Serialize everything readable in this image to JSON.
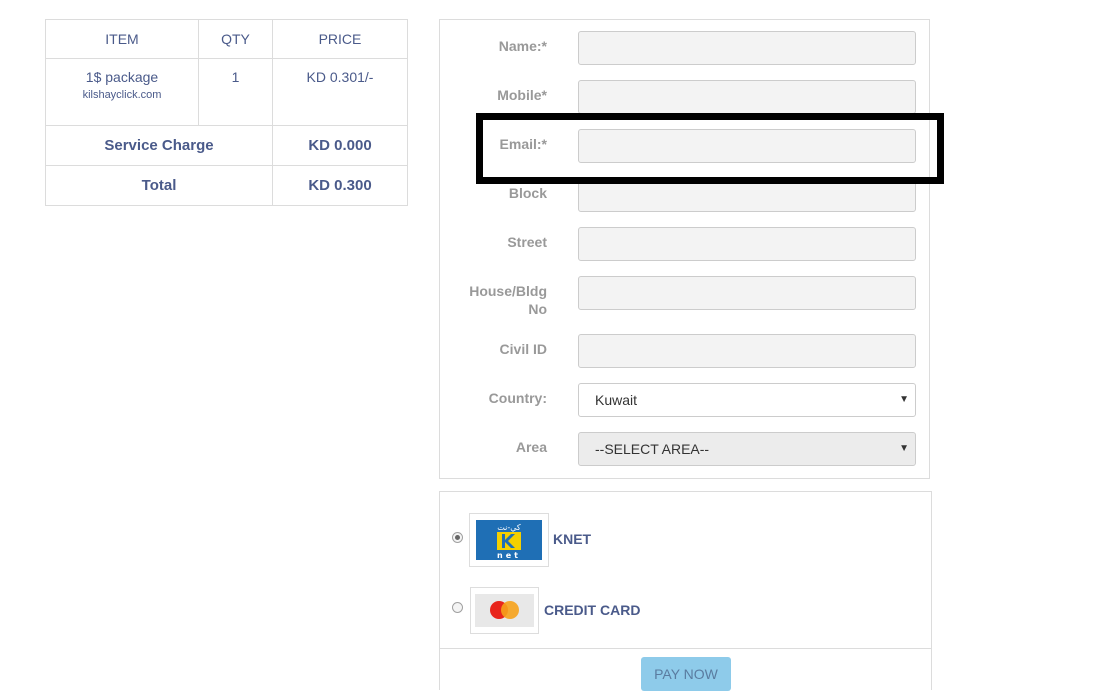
{
  "order": {
    "headers": {
      "item": "ITEM",
      "qty": "QTY",
      "price": "PRICE"
    },
    "item": {
      "name": "1$ package",
      "domain": "kilshayclick.com",
      "qty": "1",
      "price": "KD  0.301/-"
    },
    "service_charge": {
      "label": "Service Charge",
      "value": "KD 0.000"
    },
    "total": {
      "label": "Total",
      "value": "KD 0.300"
    }
  },
  "form": {
    "name_label": "Name:*",
    "mobile_label": "Mobile*",
    "email_label": "Email:*",
    "block_label": "Block",
    "street_label": "Street",
    "house_label": "House/Bldg No",
    "civil_label": "Civil ID",
    "country_label": "Country:",
    "country_value": "Kuwait",
    "area_label": "Area",
    "area_value": "--SELECT AREA--"
  },
  "payment": {
    "knet_label": "KNET",
    "knet_logo_text": "كي-نت",
    "knet_logo_sub": "net",
    "credit_label": "CREDIT CARD",
    "pay_button": "PAY NOW",
    "selected": "KNET"
  },
  "colors": {
    "accent": "#4a5a8a",
    "button": "#8ecbea",
    "knet_blue": "#1f6fb5",
    "knet_yellow": "#f4d000"
  }
}
